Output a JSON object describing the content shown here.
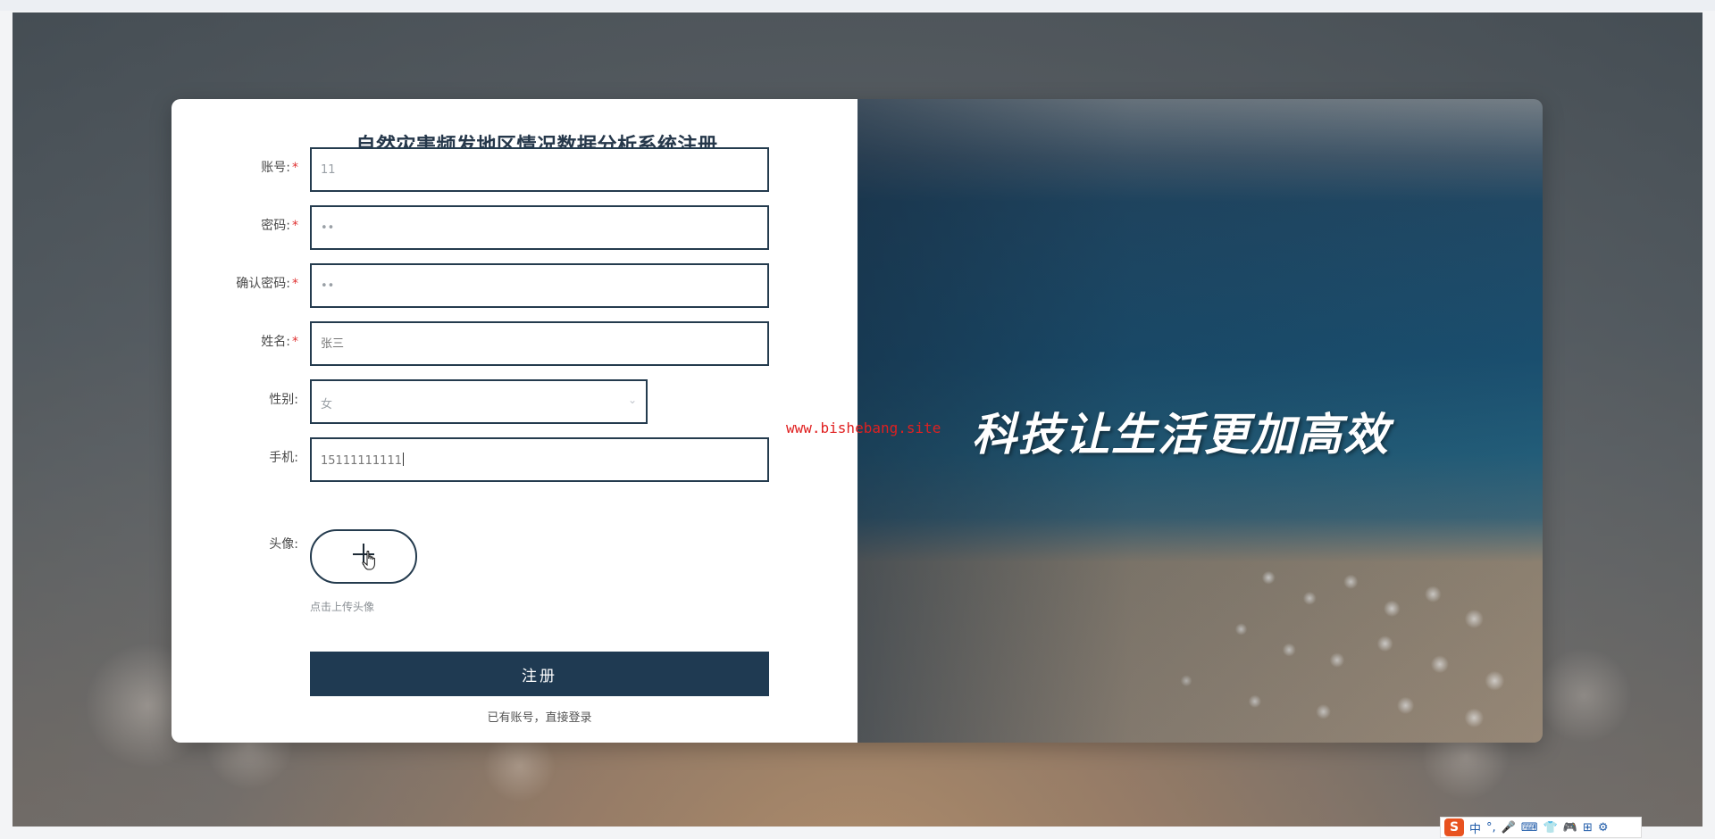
{
  "form": {
    "title": "自然灾害频发地区情况数据分析系统注册",
    "fields": {
      "account": {
        "label": "账号:",
        "value": "11",
        "required": true
      },
      "password": {
        "label": "密码:",
        "value": "••",
        "required": true
      },
      "confirm_password": {
        "label": "确认密码:",
        "value": "••",
        "required": true
      },
      "name": {
        "label": "姓名:",
        "placeholder": "张三",
        "required": true
      },
      "gender": {
        "label": "性别:",
        "value": "女"
      },
      "phone": {
        "label": "手机:",
        "value": "15111111111"
      },
      "avatar": {
        "label": "头像:",
        "hint": "点击上传头像"
      }
    },
    "required_mark": "*",
    "register_button": "注册",
    "login_link": "已有账号，直接登录"
  },
  "image_panel": {
    "slogan": "科技让生活更加高效"
  },
  "watermark": "www.bishebang.site",
  "ime_bar": {
    "logo": "S",
    "mode": "中",
    "items": [
      "°,",
      "🎤",
      "⌨",
      "👕",
      "🎮",
      "⊞",
      "⚙"
    ]
  },
  "colors": {
    "primary": "#1f3a52",
    "required": "#e03131",
    "watermark": "#e02020"
  }
}
